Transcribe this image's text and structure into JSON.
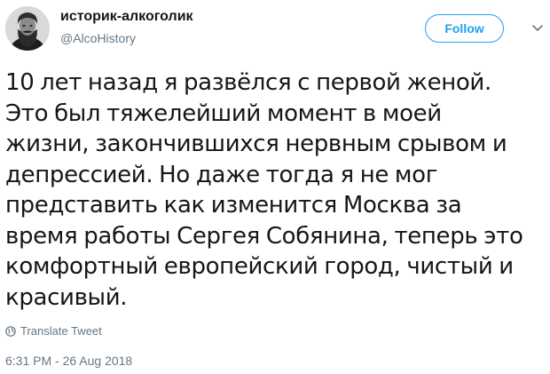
{
  "author": {
    "display_name": "историк-алкоголик",
    "handle": "@AlcoHistory"
  },
  "actions": {
    "follow_label": "Follow",
    "menu_icon": "chevron-down-icon"
  },
  "tweet": {
    "lines": [
      "10 лет назад я развёлся с первой женой.",
      "Это был тяжелейший момент в моей",
      "жизни, закончившихся нервным срывом и",
      "депрессией. Но даже тогда я не мог",
      "представить как изменится Москва за",
      "время работы Сергея Собянина, теперь это",
      "комфортный европейский город, чистый и",
      "красивый."
    ],
    "translate_label": "Translate Tweet",
    "translate_icon": "globe-icon",
    "timestamp": "6:31 PM - 26 Aug 2018"
  },
  "colors": {
    "accent": "#1da1f2",
    "text": "#14171a",
    "secondary_text": "#657786"
  }
}
